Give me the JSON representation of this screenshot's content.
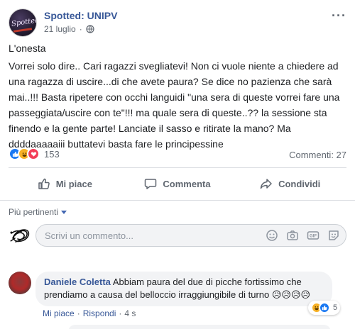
{
  "post": {
    "page_name": "Spotted: UNIPV",
    "date": "21 luglio",
    "more": "···",
    "title": "L'onesta",
    "body": "Vorrei solo dire.. Cari ragazzi svegliatevi! Non ci vuole niente a chiedere ad una ragazza di uscire...di che avete paura? Se dice no pazienza che sarà mai..!!! Basta ripetere con occhi languidi \"una sera di queste vorrei fare una passeggiata/uscire con te\"!!! ma quale sera di queste..?? la sessione sta finendo e la gente parte! Lanciate il sasso e ritirate la mano? Ma ddddaaaaaiii buttatevi basta fare le principessine",
    "avatar_text": "Spotted",
    "reaction_icons": [
      "like-icon",
      "haha-icon",
      "love-icon"
    ],
    "reaction_count": "153",
    "comments_count": "Commenti: 27"
  },
  "actions": {
    "like": "Mi piace",
    "comment": "Commenta",
    "share": "Condividi"
  },
  "comments_section": {
    "sort_label": "Più pertinenti",
    "input_placeholder": "Scrivi un commento...",
    "tools": [
      "emoji-icon",
      "camera-icon",
      "gif-icon",
      "sticker-icon"
    ]
  },
  "comments": [
    {
      "author": "Daniele Coletta",
      "text": "Abbiam paura del due di picche fortissimo che prendiamo a causa del belloccio irraggiungibile di turno 😥😥😥😥",
      "like_label": "Mi piace",
      "reply_label": "Rispondi",
      "time": "4 s",
      "reaction_icons": [
        "haha-icon",
        "like-icon"
      ],
      "reaction_count": "5"
    }
  ],
  "colors": {
    "link_blue": "#385898",
    "like_blue": "#1877f2",
    "haha_yellow": "#f7b125",
    "love_red": "#f33e58",
    "muted_text": "#606770",
    "bubble_bg": "#f2f3f5"
  }
}
